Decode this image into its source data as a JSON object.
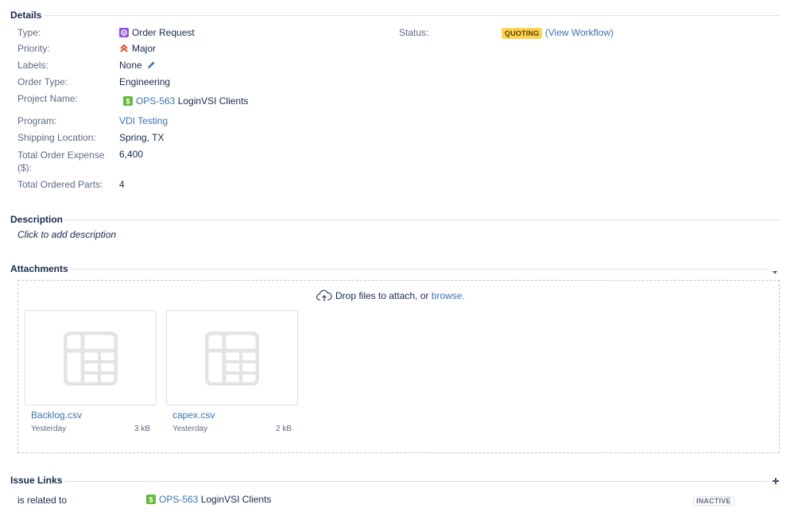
{
  "details": {
    "title": "Details",
    "type": {
      "label": "Type:",
      "value": "Order Request"
    },
    "priority": {
      "label": "Priority:",
      "value": "Major"
    },
    "labels": {
      "label": "Labels:",
      "value": "None"
    },
    "order_type": {
      "label": "Order Type:",
      "value": "Engineering"
    },
    "project_name": {
      "label": "Project Name:",
      "key": "OPS-563",
      "value": "LoginVSI Clients"
    },
    "program": {
      "label": "Program:",
      "value": "VDI Testing"
    },
    "shipping_location": {
      "label": "Shipping Location:",
      "value": "Spring, TX"
    },
    "total_order_expense": {
      "label_line1": "Total Order Expense",
      "label_line2": "($):",
      "value": "6,400"
    },
    "total_ordered_parts": {
      "label": "Total Ordered Parts:",
      "value": "4"
    },
    "status": {
      "label": "Status:",
      "badge": "QUOTING",
      "open_paren": "(",
      "workflow_link": "View Workflow",
      "close_paren": ")"
    }
  },
  "description": {
    "title": "Description",
    "placeholder": "Click to add description"
  },
  "attachments": {
    "title": "Attachments",
    "drop_text": "Drop files to attach, or",
    "browse_link": "browse.",
    "files": [
      {
        "name": "Backlog.csv",
        "date": "Yesterday",
        "size": "3 kB"
      },
      {
        "name": "capex.csv",
        "date": "Yesterday",
        "size": "2 kB"
      }
    ]
  },
  "issue_links": {
    "title": "Issue Links",
    "relation": "is related to",
    "key": "OPS-563",
    "summary": "LoginVSI Clients",
    "status_badge": "INACTIVE"
  },
  "colors": {
    "link": "#3b73af",
    "quoting_badge": "#ffd351",
    "story_icon": "#63ba3c",
    "type_icon": "#904ee2",
    "priority_major": "#de350b"
  }
}
